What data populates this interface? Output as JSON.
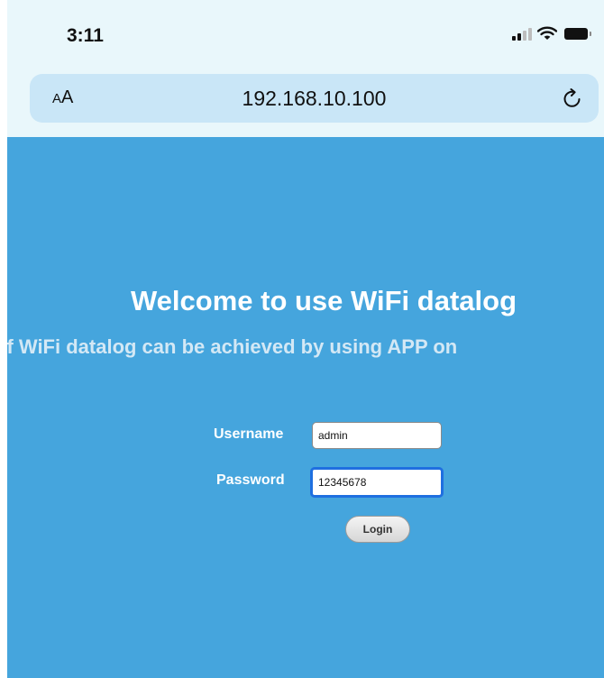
{
  "status_bar": {
    "time": "3:11",
    "icons": [
      "signal-icon",
      "wifi-icon",
      "battery-icon"
    ]
  },
  "browser": {
    "text_size_label_small": "A",
    "text_size_label_large": "A",
    "url": "192.168.10.100",
    "reload_icon": "reload-icon"
  },
  "page": {
    "heading": "Welcome to use WiFi datalog",
    "subheading": "of WiFi datalog can be achieved by using APP on",
    "background_color": "#45a5dd",
    "form": {
      "username_label": "Username",
      "username_value": "admin",
      "password_label": "Password",
      "password_value": "12345678",
      "login_label": "Login"
    }
  }
}
